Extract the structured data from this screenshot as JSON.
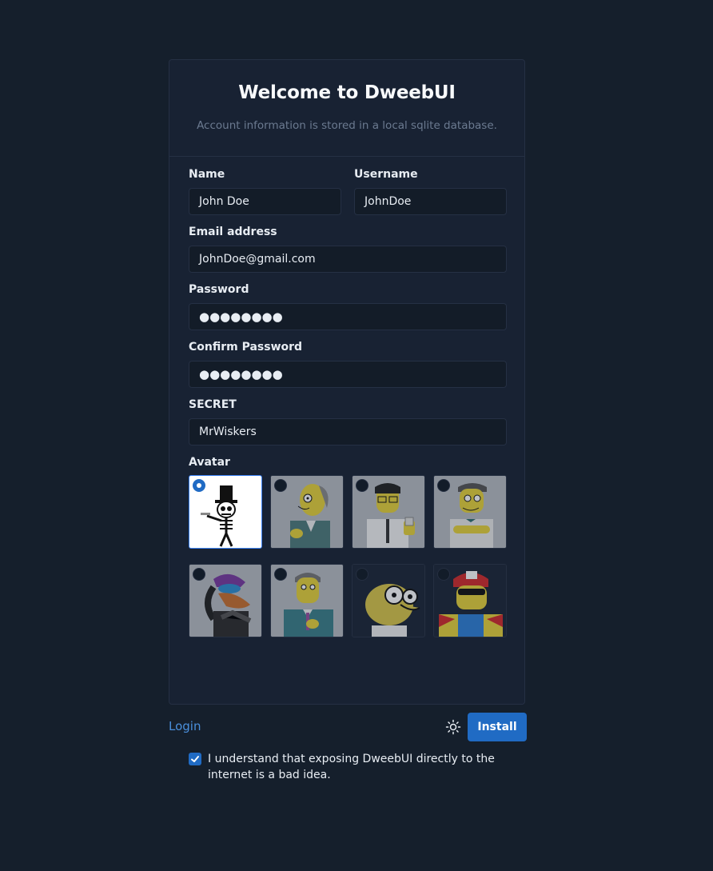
{
  "header": {
    "title": "Welcome to DweebUI",
    "subtitle": "Account information is stored in a local sqlite database."
  },
  "form": {
    "name_label": "Name",
    "name_value": "John Doe",
    "username_label": "Username",
    "username_value": "JohnDoe",
    "email_label": "Email address",
    "email_value": "JohnDoe@gmail.com",
    "password_label": "Password",
    "password_value": "●●●●●●●●",
    "confirm_label": "Confirm Password",
    "confirm_value": "●●●●●●●●",
    "secret_label": "SECRET",
    "secret_value": "MrWiskers",
    "avatar_label": "Avatar",
    "avatars": [
      {
        "name": "skeleton-tophat",
        "selected": true
      },
      {
        "name": "mr-burns",
        "selected": false
      },
      {
        "name": "frank-grimes",
        "selected": false
      },
      {
        "name": "moe",
        "selected": false
      },
      {
        "name": "poochie",
        "selected": false
      },
      {
        "name": "skinner",
        "selected": false
      },
      {
        "name": "hans-moleman",
        "selected": false
      },
      {
        "name": "duffman",
        "selected": false
      }
    ],
    "consent_checked": true,
    "consent_text": "I understand that exposing DweebUI directly to the internet is a bad idea."
  },
  "footer": {
    "login_label": "Login",
    "install_label": "Install",
    "theme_icon": "sun-icon"
  },
  "colors": {
    "background": "#151f2c",
    "card": "#182233",
    "primary": "#206bc4",
    "link": "#4a8fdc"
  }
}
